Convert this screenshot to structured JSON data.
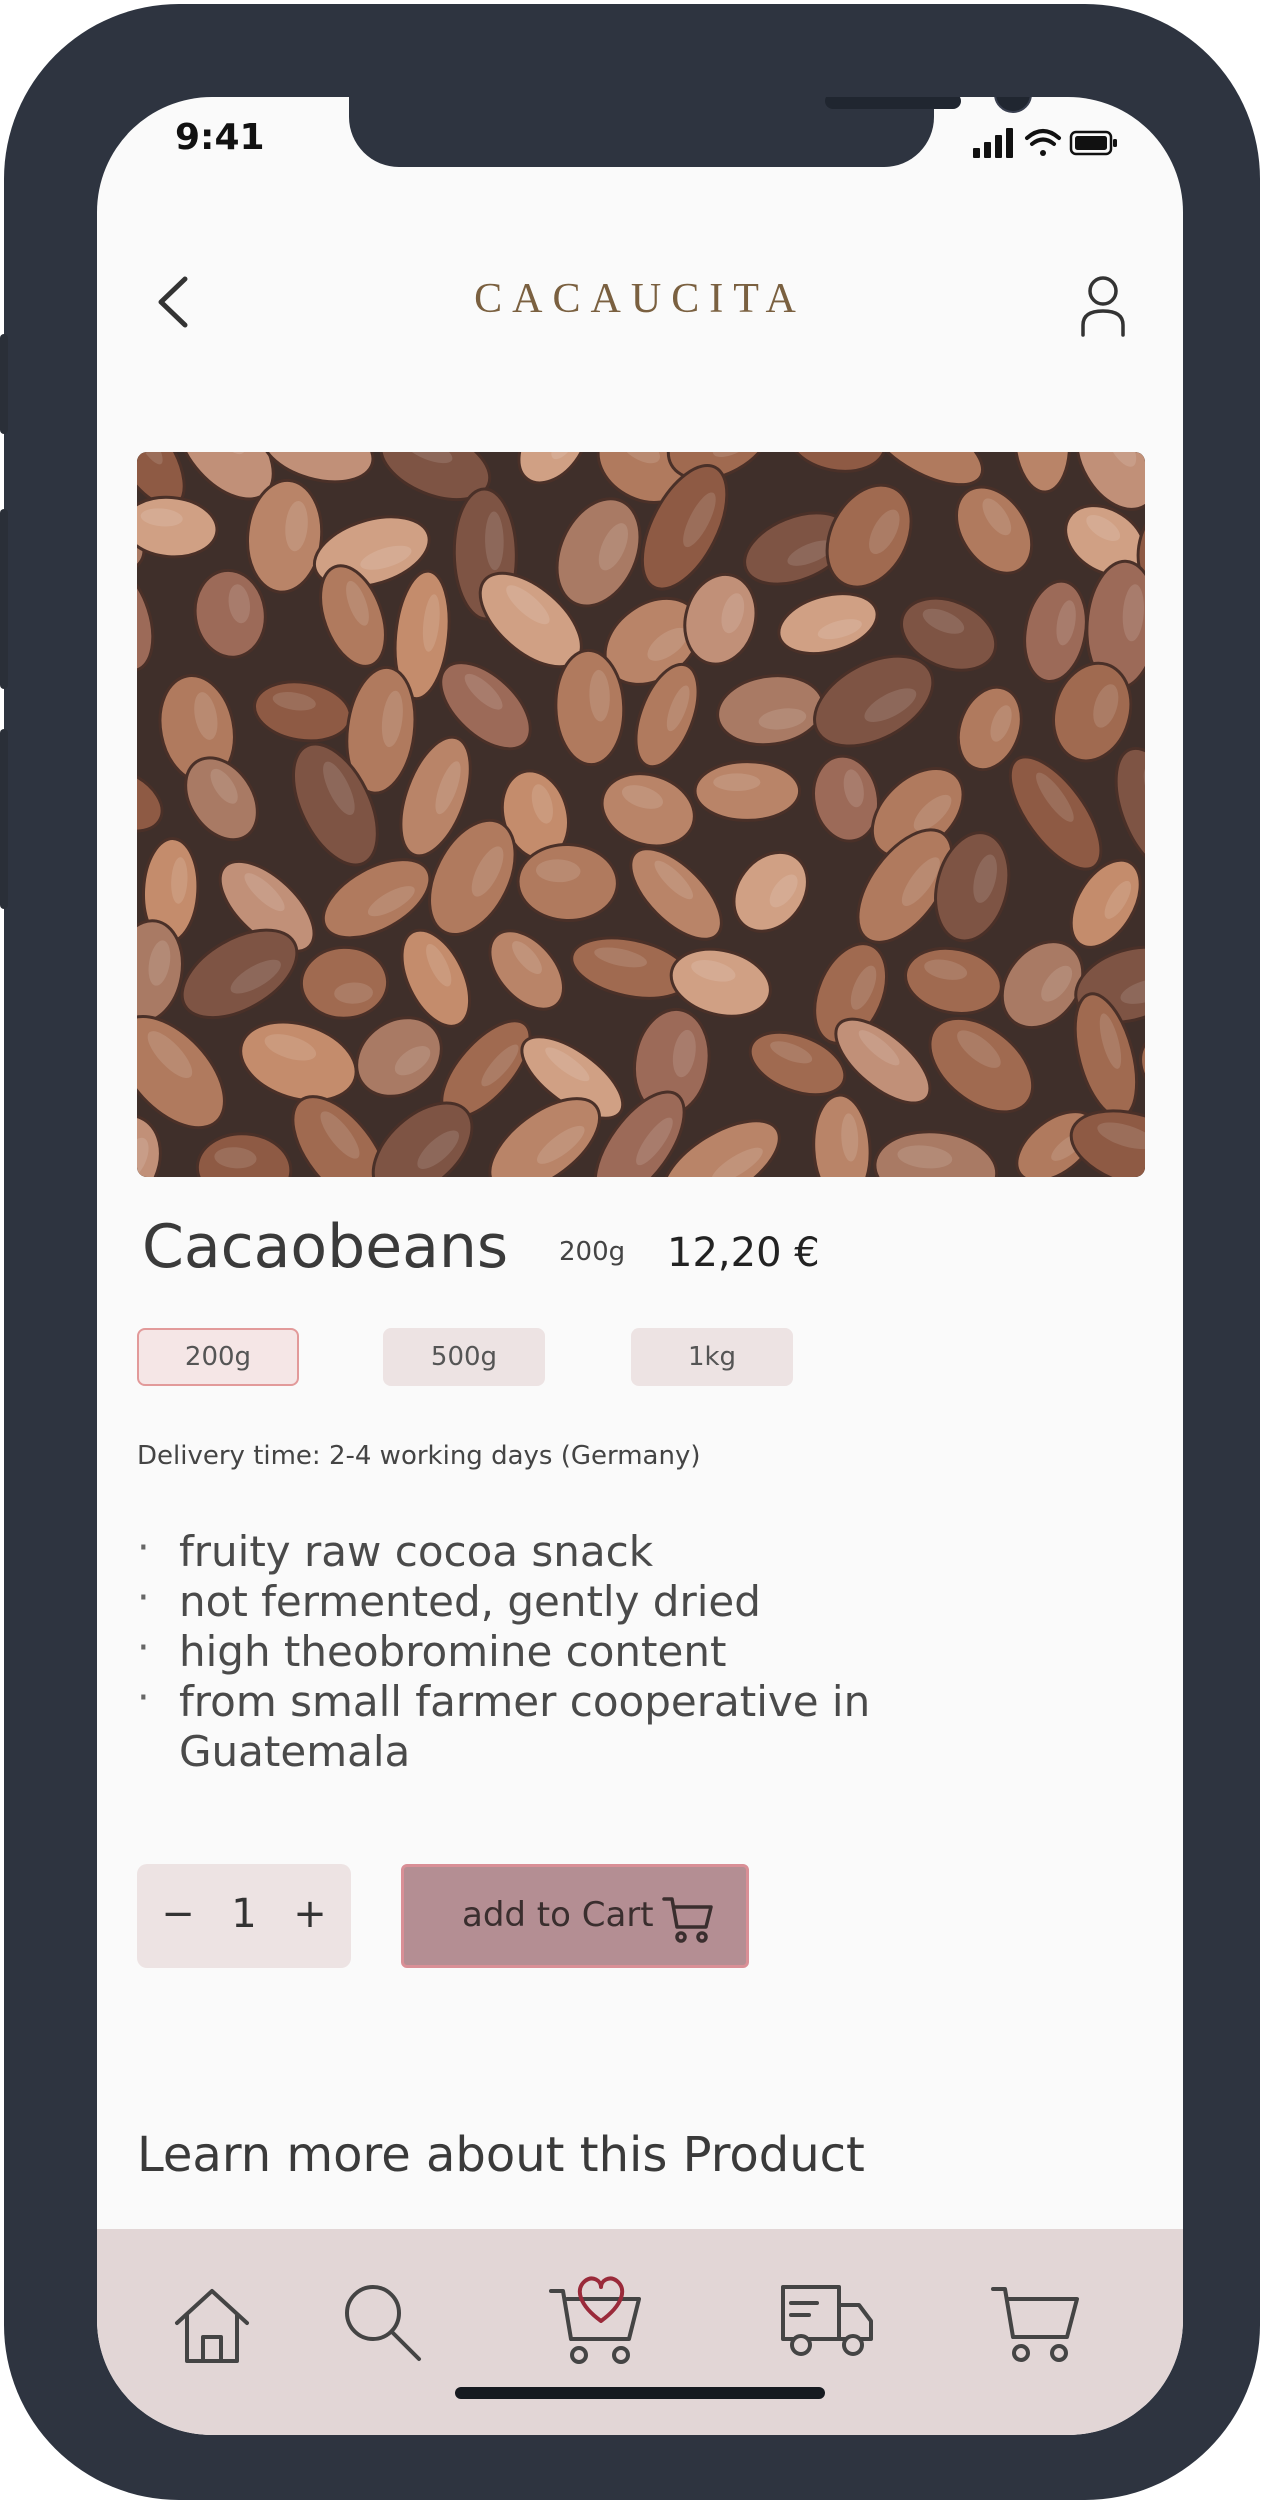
{
  "status_bar": {
    "time": "9:41"
  },
  "header": {
    "brand": "CACAUCITA"
  },
  "product": {
    "title": "Cacaobeans",
    "selected_weight": "200g",
    "price": "12,20 €",
    "weights": [
      "200g",
      "500g",
      "1kg"
    ],
    "active_weight_index": 0,
    "delivery": "Delivery time: 2-4 working days (Germany)",
    "features": [
      "fruity raw cocoa snack",
      "not fermented, gently dried",
      "high theobromine content",
      "from small farmer cooperative in Guatemala"
    ]
  },
  "quantity": {
    "minus": "−",
    "value": "1",
    "plus": "+"
  },
  "cart_button": {
    "label": "add to Cart"
  },
  "learn_more": "Learn more about this Product",
  "tabbar": {
    "items": [
      {
        "icon": "home-icon"
      },
      {
        "icon": "search-icon"
      },
      {
        "icon": "cart-heart-icon"
      },
      {
        "icon": "delivery-truck-icon"
      },
      {
        "icon": "cart-icon"
      }
    ]
  },
  "colors": {
    "phone_frame": "#2e3440",
    "screen_bg": "#fafafa",
    "option_bg": "#ede3e3",
    "option_active_border": "#e29a9a",
    "cart_button_bg": "#b48e93",
    "tabbar_bg": "#e2d6d6",
    "heart_accent": "#9a2a3a"
  }
}
